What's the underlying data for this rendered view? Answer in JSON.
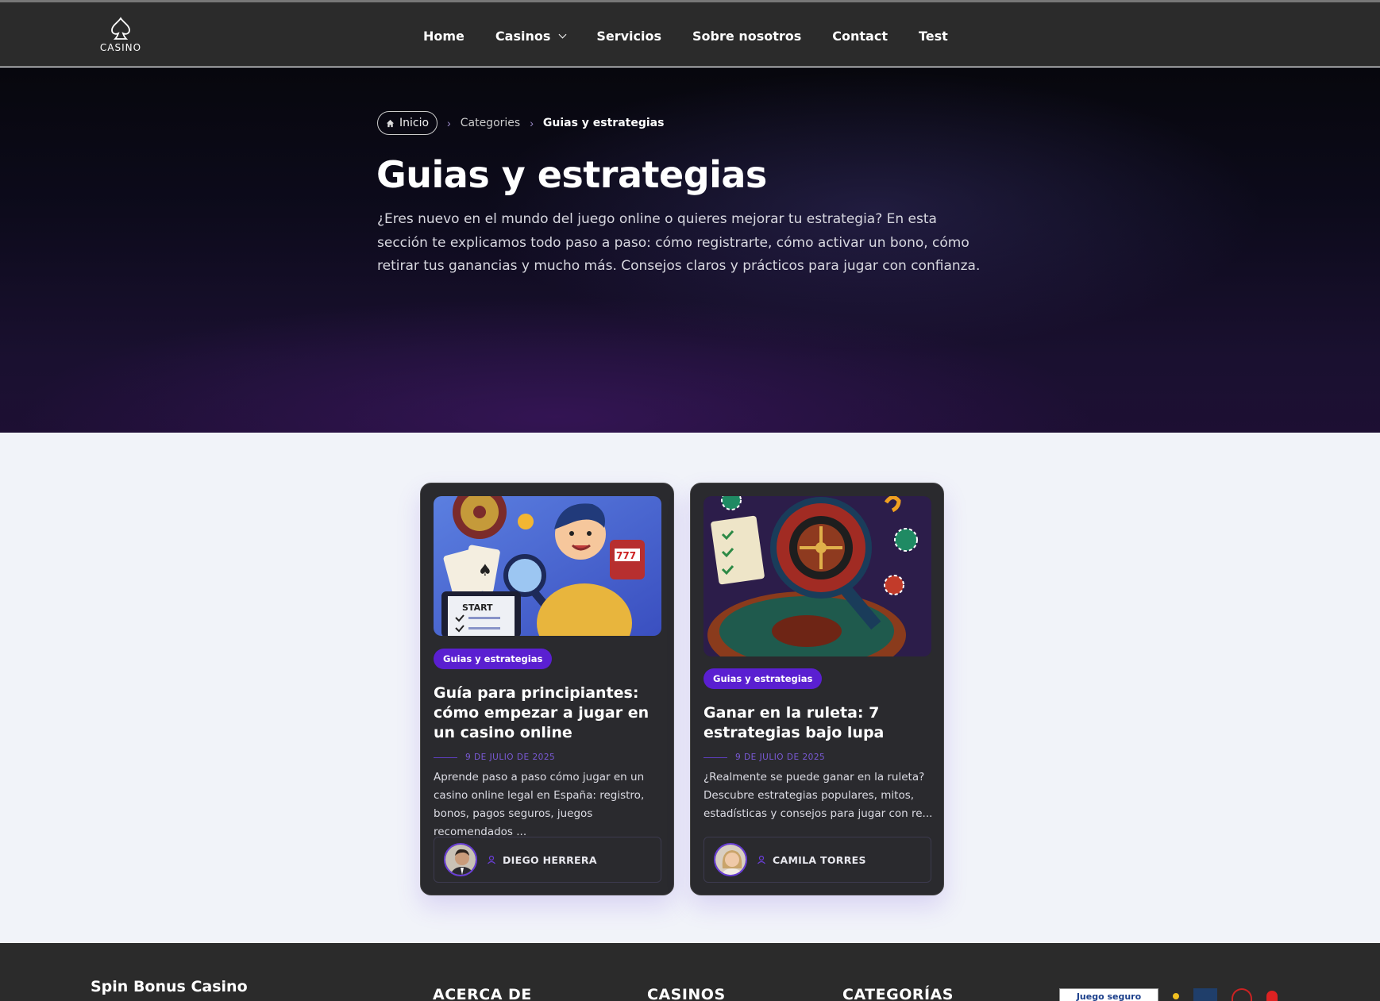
{
  "header": {
    "logo_text": "CASINO",
    "nav": [
      {
        "label": "Home"
      },
      {
        "label": "Casinos"
      },
      {
        "label": "Servicios"
      },
      {
        "label": "Sobre nosotros"
      },
      {
        "label": "Contact"
      },
      {
        "label": "Test"
      }
    ]
  },
  "hero": {
    "breadcrumb": {
      "home": "Inicio",
      "categories": "Categories",
      "current": "Guias y estrategias"
    },
    "title": "Guias y estrategias",
    "description": "¿Eres nuevo en el mundo del juego online o quieres mejorar tu estrategia? En esta sección te explicamos todo paso a paso: cómo registrarte, cómo activar un bono, cómo retirar tus ganancias y mucho más. Consejos claros y prácticos para jugar con confianza."
  },
  "cards": [
    {
      "tag": "Guias y estrategias",
      "title": "Guía para principiantes: cómo empezar a jugar en un casino online",
      "date": "9 DE JULIO DE 2025",
      "excerpt": "Aprende paso a paso cómo jugar en un casino online legal en España: registro, bonos, pagos seguros, juegos recomendados ...",
      "author": "DIEGO HERRERA",
      "image_label": "START"
    },
    {
      "tag": "Guias y estrategias",
      "title": "Ganar en la ruleta: 7 estrategias bajo lupa",
      "date": "9 DE JULIO DE 2025",
      "excerpt": "¿Realmente se puede ganar en la ruleta? Descubre estrategias populares, mitos, estadísticas y consejos para jugar con re...",
      "author": "CAMILA TORRES"
    }
  ],
  "footer": {
    "brand": "Spin Bonus Casino",
    "columns": [
      "ACERCA DE",
      "CASINOS",
      "CATEGORÍAS"
    ],
    "badge": "Juego seguro"
  },
  "colors": {
    "accent": "#5a1fd1",
    "header_bg": "#2b2b2b",
    "page_bg": "#f1f3f9"
  }
}
